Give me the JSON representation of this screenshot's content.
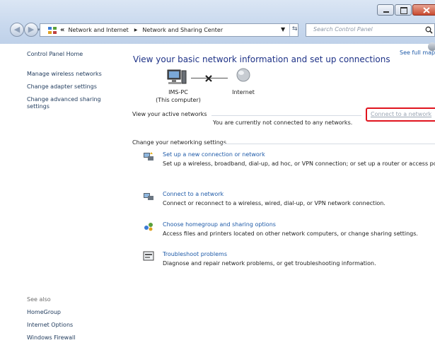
{
  "window": {
    "controls": [
      "minimize",
      "maximize",
      "close"
    ]
  },
  "address": {
    "overflow": "«",
    "crumbs": [
      "Network and Internet",
      "Network and Sharing Center"
    ],
    "dropdown_icon": "chevron-down-icon",
    "refresh_icon": "refresh-icon"
  },
  "search": {
    "placeholder": "Search Control Panel",
    "icon": "search-icon"
  },
  "sidebar": {
    "home": "Control Panel Home",
    "links": [
      "Manage wireless networks",
      "Change adapter settings",
      "Change advanced sharing settings"
    ],
    "see_also_heading": "See also",
    "see_also": [
      "HomeGroup",
      "Internet Options",
      "Windows Firewall"
    ]
  },
  "main": {
    "title": "View your basic network information and set up connections",
    "see_full_map": "See full map",
    "computer_name": "IMS-PC",
    "computer_sub": "(This computer)",
    "internet_label": "Internet",
    "active_heading": "View your active networks",
    "not_connected": "You are currently not connected to any networks.",
    "connect_link": "Connect to a network",
    "highlight_color": "#e0141e",
    "change_heading": "Change your networking settings",
    "tasks": [
      {
        "title": "Set up a new connection or network",
        "desc": "Set up a wireless, broadband, dial-up, ad hoc, or VPN connection; or set up a router or access point."
      },
      {
        "title": "Connect to a network",
        "desc": "Connect or reconnect to a wireless, wired, dial-up, or VPN network connection."
      },
      {
        "title": "Choose homegroup and sharing options",
        "desc": "Access files and printers located on other network computers, or change sharing settings."
      },
      {
        "title": "Troubleshoot problems",
        "desc": "Diagnose and repair network problems, or get troubleshooting information."
      }
    ]
  }
}
